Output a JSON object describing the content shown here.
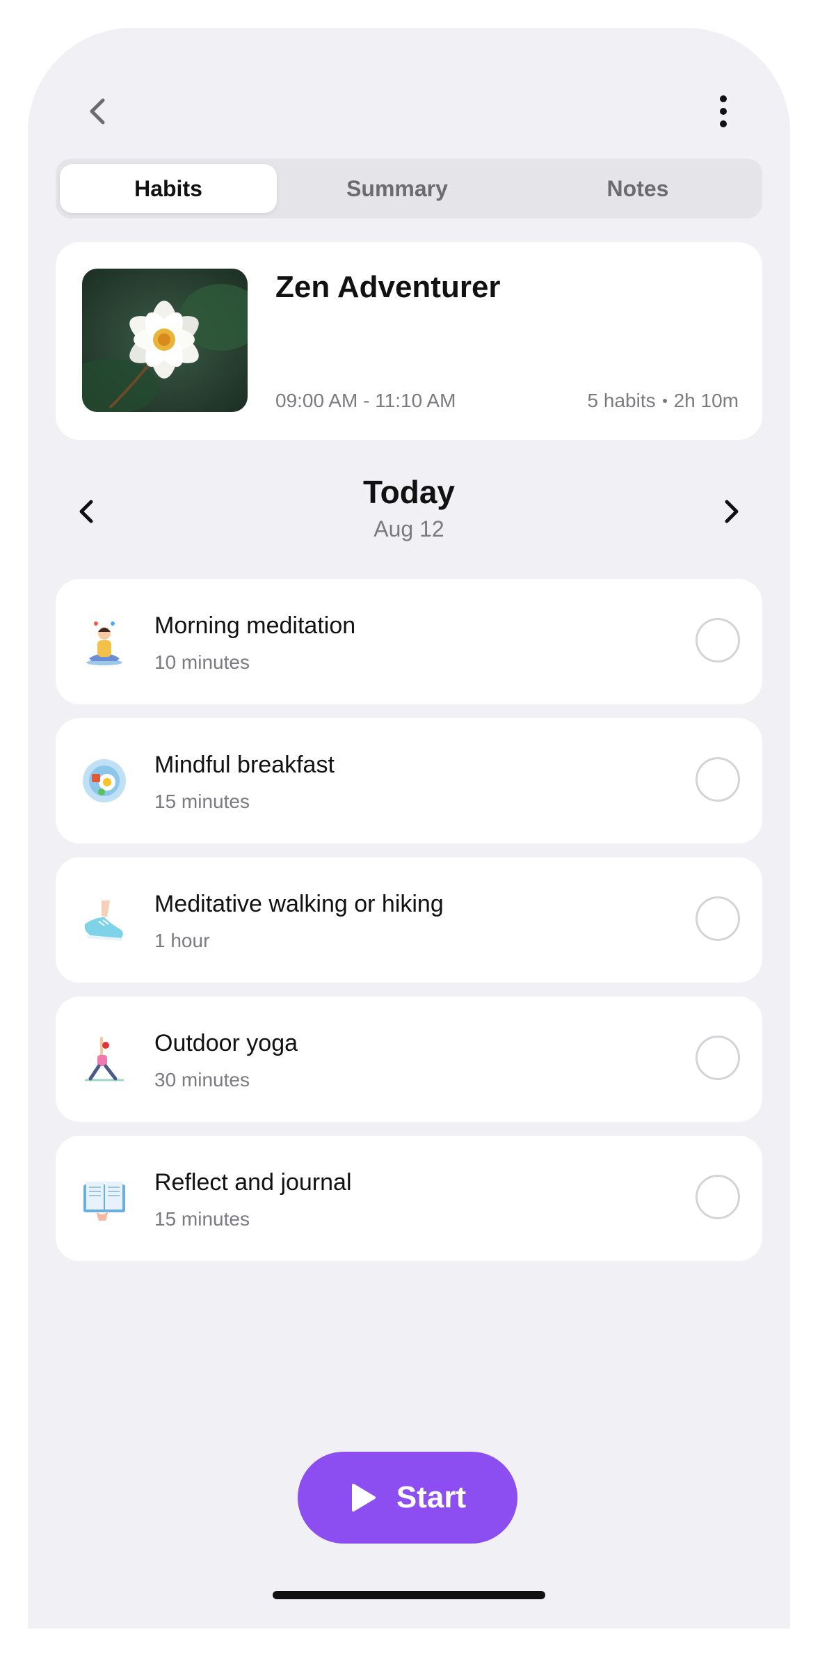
{
  "header": {
    "back_icon": "chevron-left-icon",
    "more_icon": "vertical-ellipsis-icon"
  },
  "tabs": [
    {
      "label": "Habits",
      "active": true
    },
    {
      "label": "Summary",
      "active": false
    },
    {
      "label": "Notes",
      "active": false
    }
  ],
  "routine": {
    "title": "Zen Adventurer",
    "time_range": "09:00 AM - 11:10 AM",
    "habit_count": "5 habits",
    "total_duration": "2h 10m",
    "image": "white-water-lily"
  },
  "day": {
    "title": "Today",
    "date": "Aug 12",
    "prev_icon": "chevron-left-icon",
    "next_icon": "chevron-right-icon"
  },
  "habits": [
    {
      "name": "Morning meditation",
      "duration": "10 minutes",
      "icon": "meditation-icon",
      "done": false
    },
    {
      "name": "Mindful breakfast",
      "duration": "15 minutes",
      "icon": "breakfast-plate-icon",
      "done": false
    },
    {
      "name": "Meditative walking or hiking",
      "duration": "1 hour",
      "icon": "sneaker-icon",
      "done": false
    },
    {
      "name": "Outdoor yoga",
      "duration": "30 minutes",
      "icon": "yoga-pose-icon",
      "done": false
    },
    {
      "name": "Reflect and journal",
      "duration": "15 minutes",
      "icon": "open-journal-icon",
      "done": false
    }
  ],
  "start_button": {
    "label": "Start",
    "icon": "play-icon"
  },
  "colors": {
    "background": "#f0f0f5",
    "card": "#ffffff",
    "accent": "#8c4ef0",
    "muted_text": "#7a7a80"
  }
}
